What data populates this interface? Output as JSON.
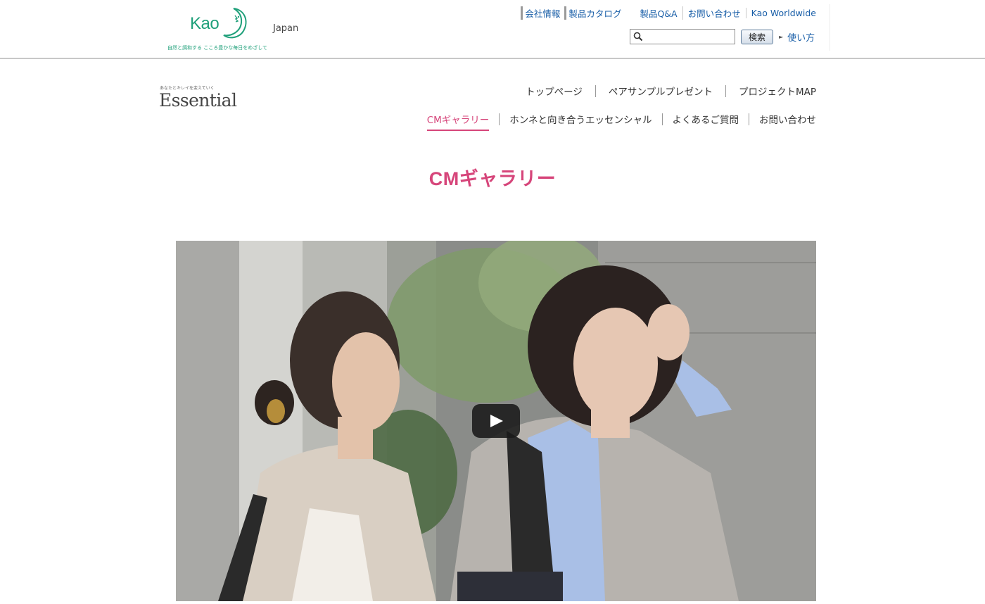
{
  "kao_header": {
    "logo_text": "Kao",
    "tagline": "自然と調和する こころ豊かな毎日をめざして",
    "region": "Japan",
    "utility_links": [
      "会社情報",
      "製品カタログ",
      "製品Q&A",
      "お問い合わせ",
      "Kao Worldwide"
    ],
    "search": {
      "placeholder": "",
      "value": "",
      "button_label": "検索",
      "howto_label": "使い方"
    }
  },
  "brand": {
    "logo_small_text": "あなたとキレイを変えていく",
    "logo_text": "Essential",
    "nav_top": [
      "トップページ",
      "ペアサンプルプレゼント",
      "プロジェクトMAP"
    ],
    "nav_bottom": [
      "CMギャラリー",
      "ホンネと向き合うエッセンシャル",
      "よくあるご質問",
      "お問い合わせ"
    ],
    "active_nav": "CMギャラリー"
  },
  "page_title": "CMギャラリー",
  "colors": {
    "accent": "#d6457a",
    "kao_green": "#1fa07a",
    "link": "#1a5fa8"
  },
  "video": {
    "play_icon": "play-icon"
  }
}
